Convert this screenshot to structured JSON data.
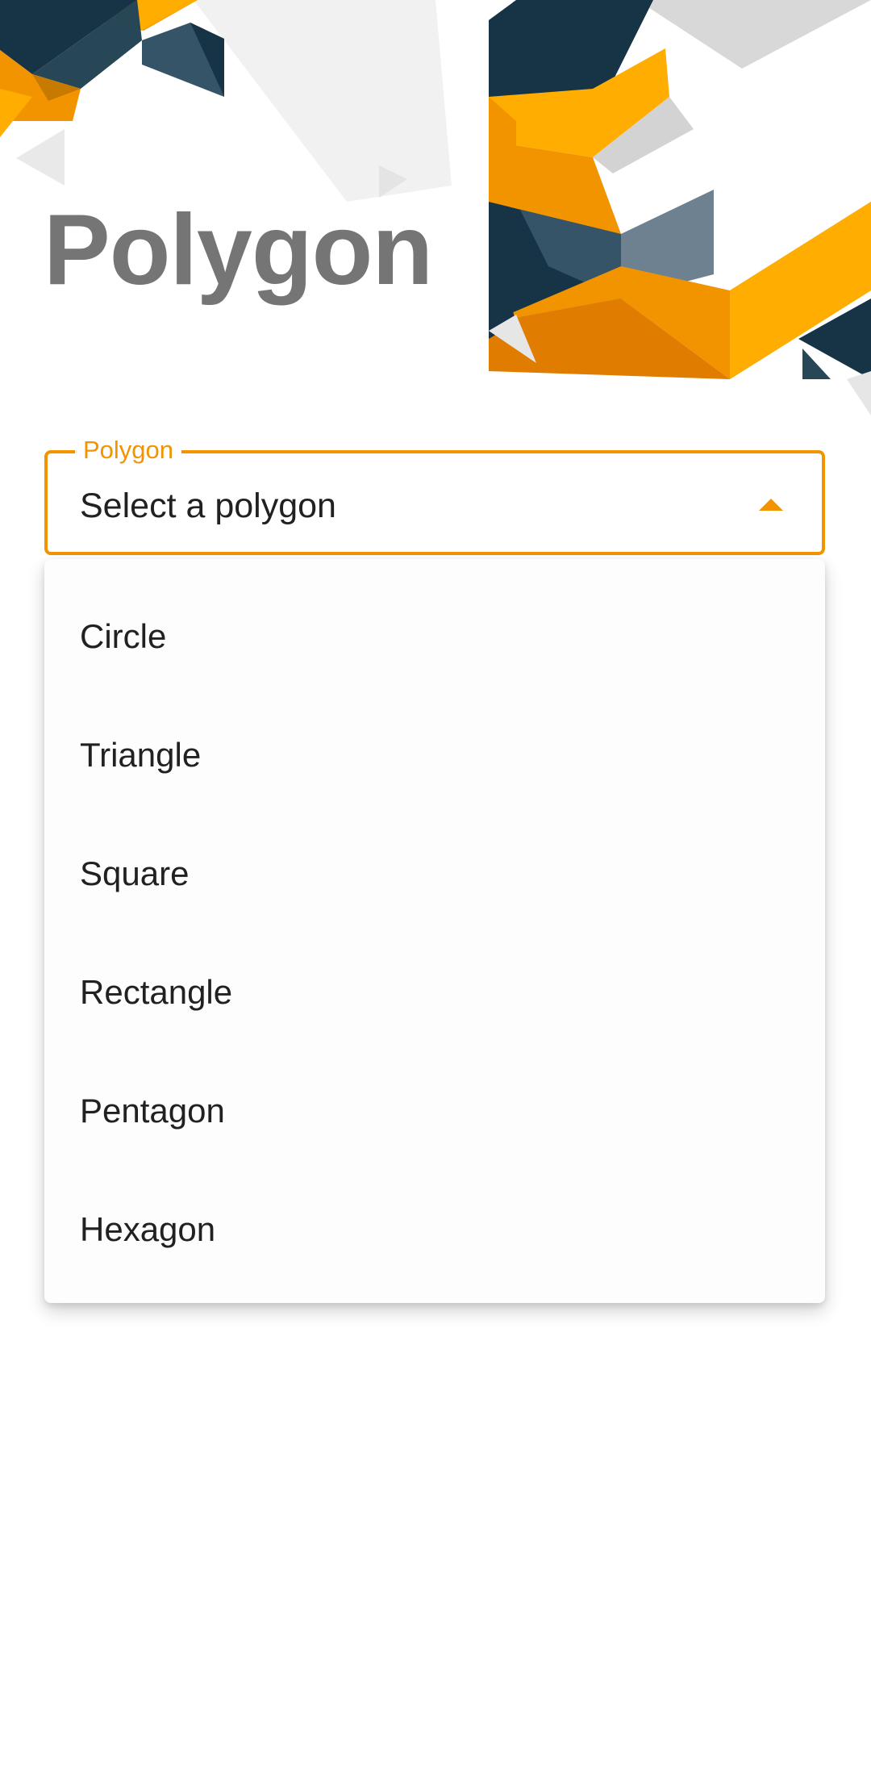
{
  "page": {
    "title": "Polygon"
  },
  "select": {
    "label": "Polygon",
    "value": "Select a polygon",
    "accent_color": "#f29400"
  },
  "menu": {
    "options": [
      {
        "label": "Circle"
      },
      {
        "label": "Triangle"
      },
      {
        "label": "Square"
      },
      {
        "label": "Rectangle"
      },
      {
        "label": "Pentagon"
      },
      {
        "label": "Hexagon"
      }
    ]
  },
  "theme": {
    "navy": "#173447",
    "slate": "#355468",
    "orange": "#f29400",
    "amber": "#ffad00",
    "gray_blue": "#6d8190"
  }
}
